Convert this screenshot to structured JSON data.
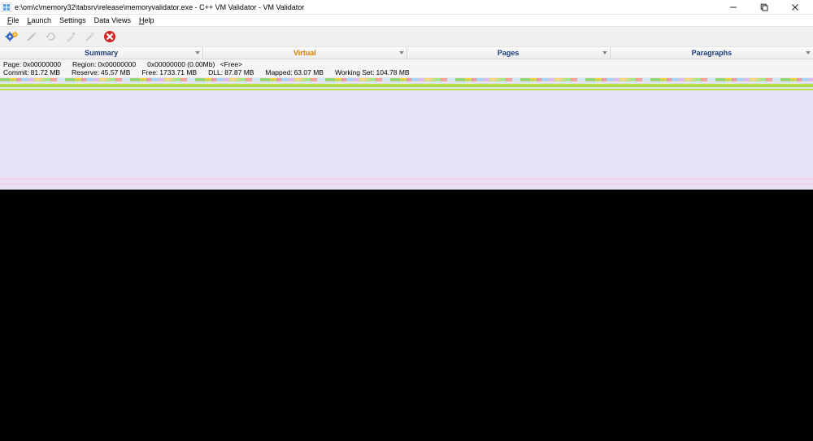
{
  "window": {
    "title": "e:\\om\\c\\memory32\\tabsrv\\release\\memoryvalidator.exe - C++ VM Validator - VM Validator"
  },
  "menu": {
    "file": "File",
    "launch": "Launch",
    "settings": "Settings",
    "data_views": "Data Views",
    "help": "Help"
  },
  "tabs": {
    "summary": "Summary",
    "virtual": "Virtual",
    "pages": "Pages",
    "paragraphs": "Paragraphs",
    "active": "virtual"
  },
  "stats": {
    "line1": {
      "page": {
        "label": "Page:",
        "value": "0x00000000"
      },
      "region": {
        "label": "Region:",
        "value": "0x00000000"
      },
      "address": {
        "value": "0x00000000 (0.00Mb)"
      },
      "tag": "<Free>"
    },
    "line2": {
      "commit": {
        "label": "Commit:",
        "value": "81.72 MB"
      },
      "reserve": {
        "label": "Reserve:",
        "value": "45.57 MB"
      },
      "free": {
        "label": "Free:",
        "value": "1733.71 MB"
      },
      "dll": {
        "label": "DLL:",
        "value": "87.87 MB"
      },
      "mapped": {
        "label": "Mapped:",
        "value": "63.07 MB"
      },
      "working_set": {
        "label": "Working Set:",
        "value": "104.78 MB"
      }
    }
  },
  "toolbar_icons": {
    "gear": "settings-gear-icon",
    "wand1": "wand-icon",
    "wand2": "refresh-icon",
    "wand3": "brush-icon",
    "cancel": "cancel-icon"
  },
  "colors": {
    "tab_active": "#d97a00",
    "tab_inactive": "#1a3d7a"
  }
}
